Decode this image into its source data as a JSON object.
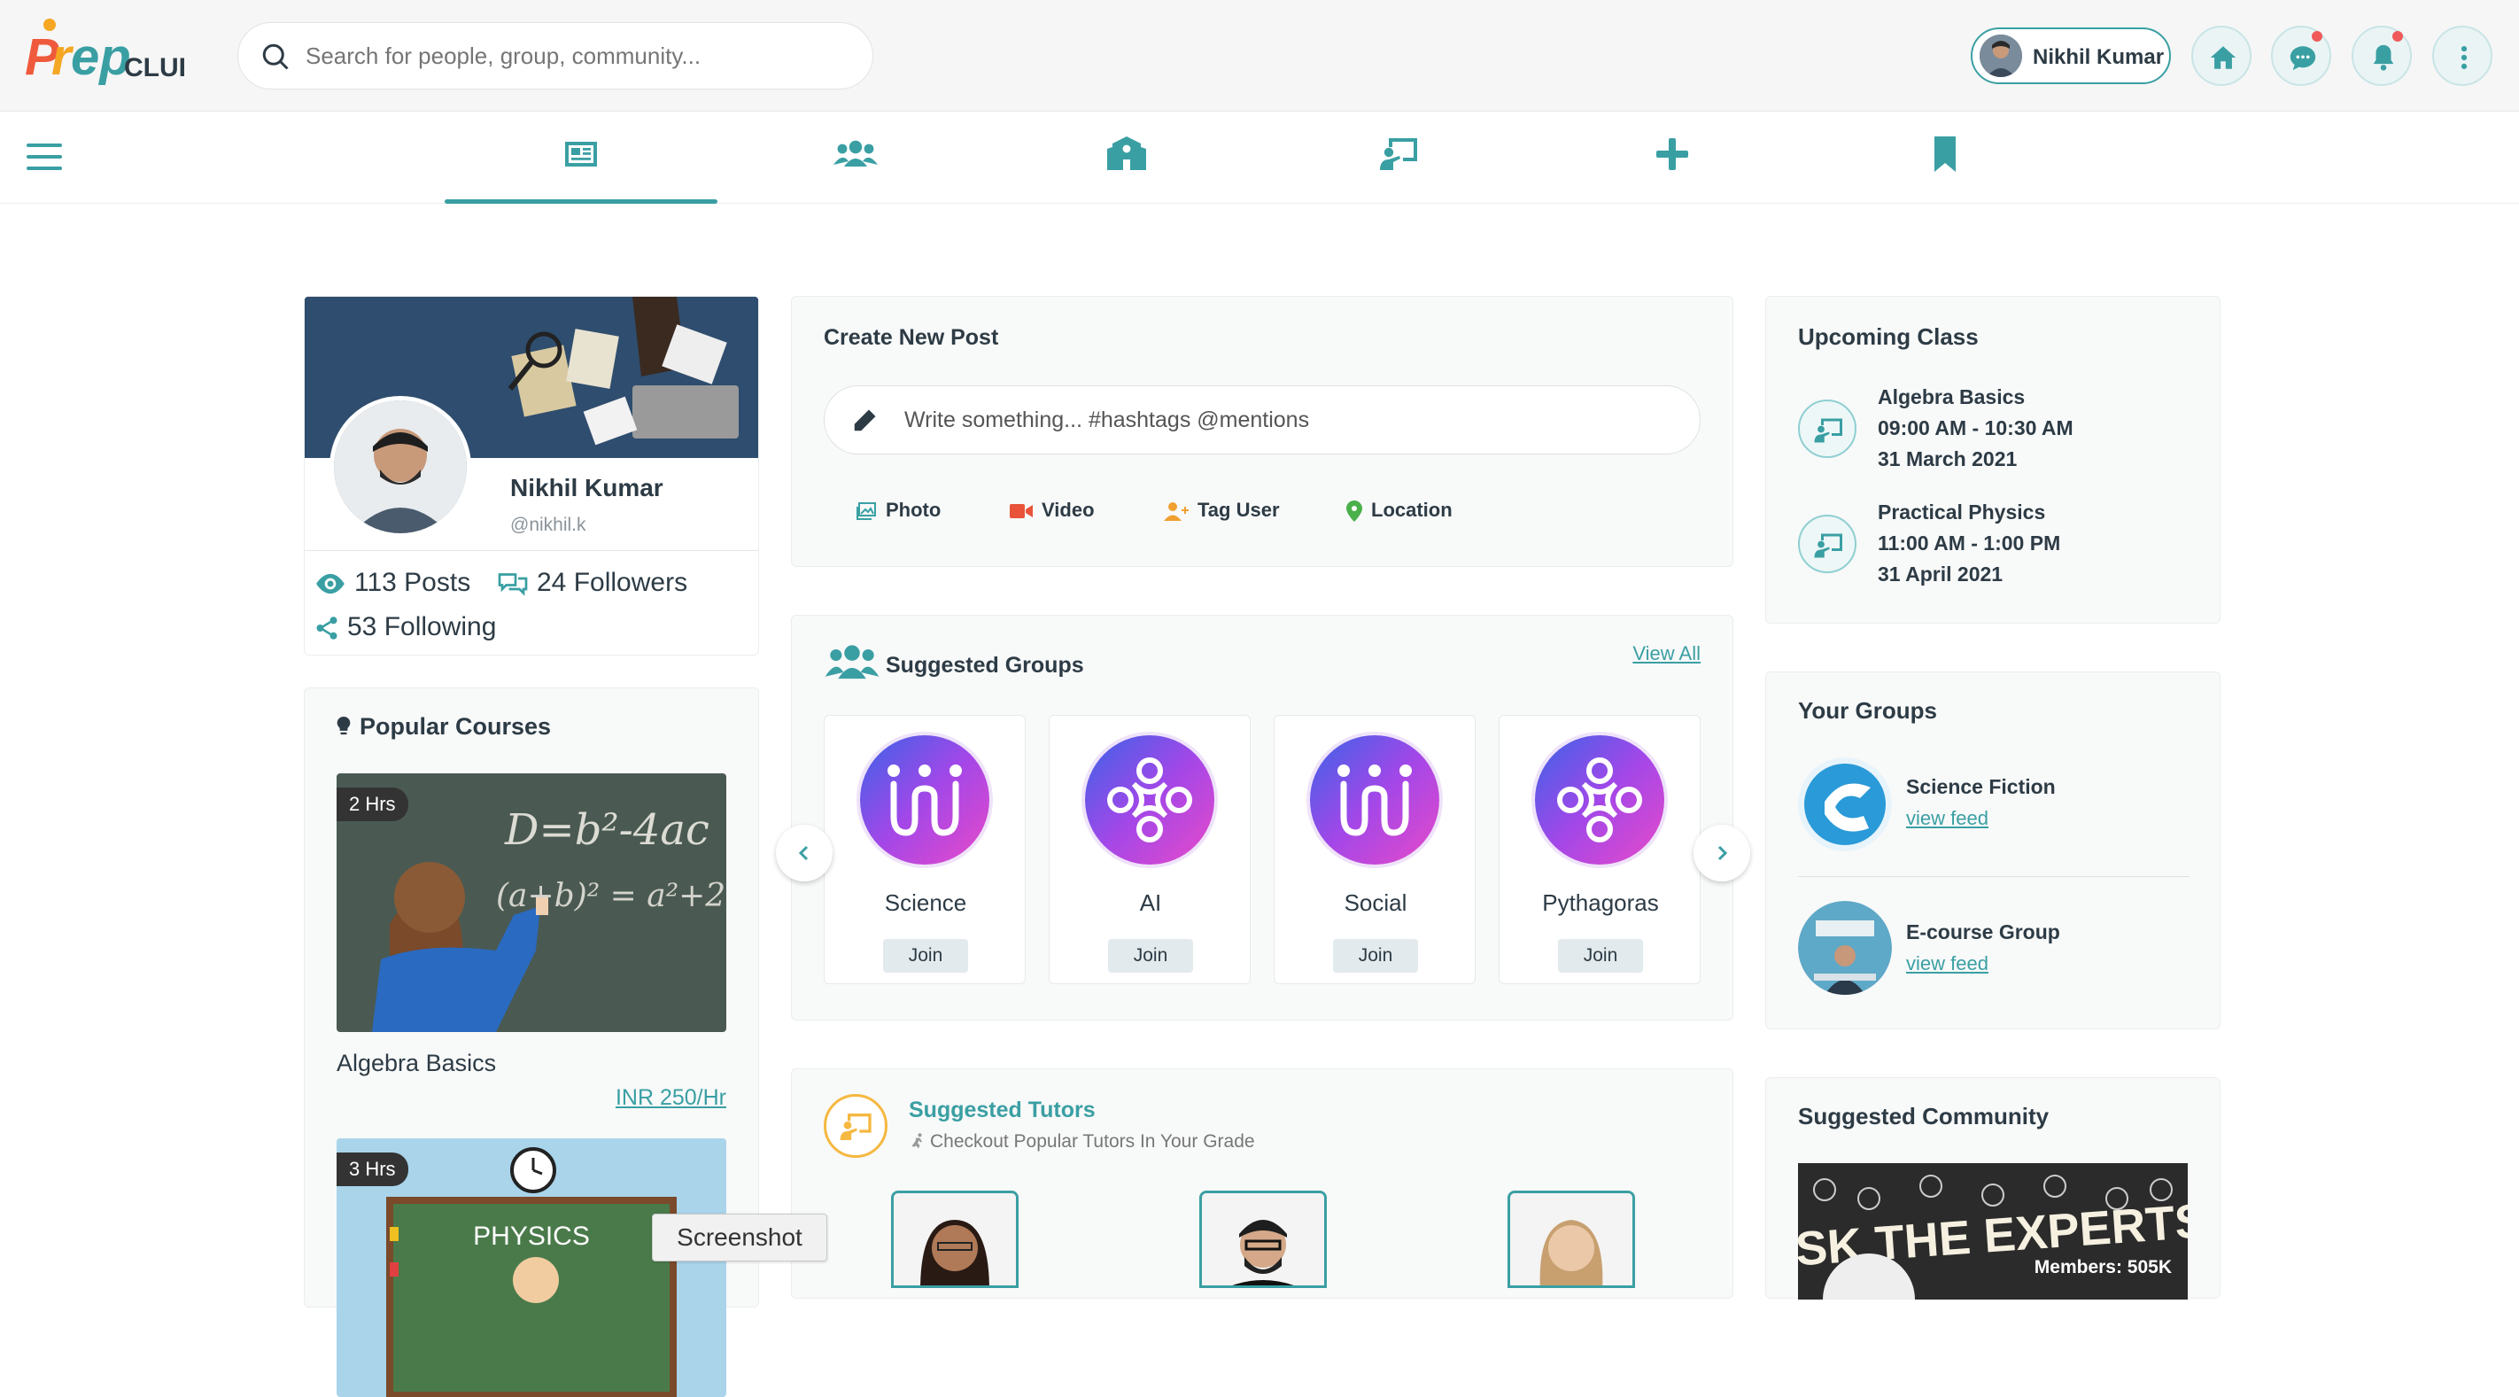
{
  "header": {
    "logo_text": "PREP CLUB",
    "search_placeholder": "Search for people, group, community...",
    "user_name": "Nikhil Kumar"
  },
  "profile": {
    "name": "Nikhil Kumar",
    "handle": "@nikhil.k",
    "posts": "113 Posts",
    "followers": "24 Followers",
    "following": "53 Following"
  },
  "popular_courses": {
    "title": "Popular Courses",
    "items": [
      {
        "duration": "2 Hrs",
        "name": "Algebra Basics",
        "price": "INR 250/Hr"
      },
      {
        "duration": "3 Hrs",
        "board_text": "PHYSICS"
      }
    ]
  },
  "create_post": {
    "title": "Create New Post",
    "placeholder": "Write something... #hashtags @mentions",
    "actions": [
      "Photo",
      "Video",
      "Tag User",
      "Location"
    ]
  },
  "suggested_groups": {
    "title": "Suggested Groups",
    "view_all": "View All",
    "join_label": "Join",
    "groups": [
      "Science",
      "AI",
      "Social",
      "Pythagoras"
    ]
  },
  "suggested_tutors": {
    "title": "Suggested Tutors",
    "subtitle": "Checkout Popular Tutors In Your Grade"
  },
  "upcoming_class": {
    "title": "Upcoming Class",
    "classes": [
      {
        "name": "Algebra Basics",
        "time": "09:00 AM - 10:30 AM",
        "date": "31 March 2021"
      },
      {
        "name": "Practical Physics",
        "time": "11:00 AM - 1:00 PM",
        "date": "31 April 2021"
      }
    ]
  },
  "your_groups": {
    "title": "Your Groups",
    "link_label": "view feed",
    "groups": [
      {
        "name": "Science Fiction"
      },
      {
        "name": "E-course Group"
      }
    ]
  },
  "suggested_community": {
    "title": "Suggested Community",
    "banner_text": "ASK THE EXPERTS!",
    "members": "Members: 505K"
  },
  "tooltip": "Screenshot"
}
